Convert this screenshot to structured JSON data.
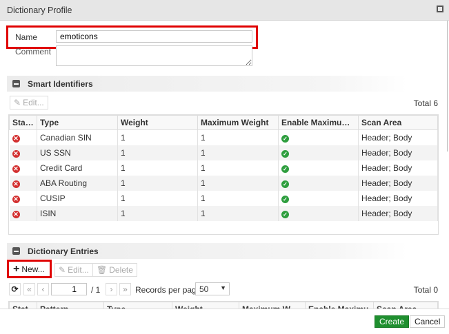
{
  "window": {
    "title": "Dictionary Profile"
  },
  "form": {
    "name_label": "Name",
    "name_value": "emoticons",
    "comment_label": "Comment",
    "comment_value": ""
  },
  "smart": {
    "title": "Smart Identifiers",
    "edit_label": "Edit...",
    "total": "Total 6",
    "columns": [
      "Stat...",
      "Type",
      "Weight",
      "Maximum Weight",
      "Enable Maximum W...",
      "Scan Area"
    ],
    "rows": [
      {
        "type": "Canadian SIN",
        "weight": "1",
        "max": "1",
        "scan": "Header; Body"
      },
      {
        "type": "US SSN",
        "weight": "1",
        "max": "1",
        "scan": "Header; Body"
      },
      {
        "type": "Credit Card",
        "weight": "1",
        "max": "1",
        "scan": "Header; Body"
      },
      {
        "type": "ABA Routing",
        "weight": "1",
        "max": "1",
        "scan": "Header; Body"
      },
      {
        "type": "CUSIP",
        "weight": "1",
        "max": "1",
        "scan": "Header; Body"
      },
      {
        "type": "ISIN",
        "weight": "1",
        "max": "1",
        "scan": "Header; Body"
      }
    ]
  },
  "entries": {
    "title": "Dictionary Entries",
    "new_label": "New...",
    "edit_label": "Edit...",
    "delete_label": "Delete",
    "page": "1",
    "page_of": "/ 1",
    "records_label": "Records per page",
    "per_page": "50",
    "total": "Total 0",
    "columns": [
      "Stat",
      "Pattern",
      "Type",
      "Weight",
      "Maximum Weight",
      "Enable Maximu",
      "Scan Area"
    ]
  },
  "footer": {
    "create": "Create",
    "cancel": "Cancel"
  },
  "colors": {
    "accent": "#1f8f2f",
    "highlight": "#e00000"
  }
}
